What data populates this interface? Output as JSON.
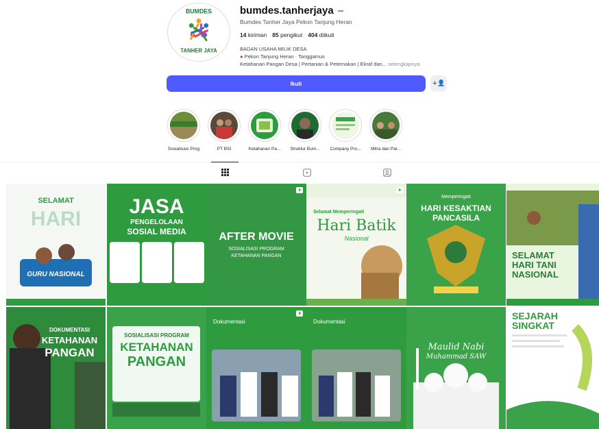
{
  "profile": {
    "username": "bumdes.tanherjaya",
    "fullname": "Bumdes Tanher Jaya Pekon Tanjung Heran",
    "stats": [
      {
        "count": "14",
        "label": "kiriman"
      },
      {
        "count": "85",
        "label": "pengikut"
      },
      {
        "count": "404",
        "label": "diikuti"
      }
    ],
    "bio_line1": "BADAN USAHA MILIK DESA",
    "bio_line2": "Pekon Tanjung Heran · Tanggamus",
    "bio_line3": "Ketahanan Pangan Desa | Pertanian & Peternakan | Ekraf dan...",
    "bio_more": "selengkapnya",
    "logo_top": "BUMDES",
    "logo_bottom": "TANHER JAYA"
  },
  "actions": {
    "follow_label": "Ikuti",
    "adduser_icon": "add-user-icon"
  },
  "highlights": [
    {
      "label": "Sosialisasi Prog"
    },
    {
      "label": "PT BSI"
    },
    {
      "label": "Ketahanan Pa..."
    },
    {
      "label": "Struktur Bum..."
    },
    {
      "label": "Company Pro..."
    },
    {
      "label": "Mitra dan Par..."
    }
  ],
  "tabs": [
    {
      "icon": "grid-icon",
      "active": true
    },
    {
      "icon": "reels-icon",
      "active": false
    },
    {
      "icon": "tagged-icon",
      "active": false
    }
  ],
  "posts": [
    {
      "line1": "SELAMAT",
      "line2": "HARI",
      "line3": "GURU NASIONAL"
    },
    {
      "line1": "JASA",
      "line2": "PENGELOLAAN",
      "line3": "SOSIAL MEDIA"
    },
    {
      "line1": "AFTER MOVIE",
      "line2": "SOSIALISASI PROGRAM",
      "line3": "KETAHANAN PANGAN"
    },
    {
      "line1": "Selamat Memperingati",
      "line2": "Hari Batik",
      "line3": "Nasional"
    },
    {
      "line1": "Memperingati",
      "line2": "HARI KESAKTIAN",
      "line3": "PANCASILA"
    },
    {
      "line1": "SELAMAT",
      "line2": "HARI TANI",
      "line3": "NASIONAL"
    },
    {
      "line1": "DOKUMENTASI",
      "line2": "KETAHANAN",
      "line3": "PANGAN"
    },
    {
      "line1": "SOSIALISASI PROGRAM",
      "line2": "KETAHANAN",
      "line3": "PANGAN"
    },
    {
      "line1": "Dokumentasi",
      "line2": "",
      "line3": ""
    },
    {
      "line1": "Dokumentasi",
      "line2": "",
      "line3": ""
    },
    {
      "line1": "Maulid Nabi",
      "line2": "Muhammad SAW",
      "line3": ""
    },
    {
      "line1": "SEJARAH",
      "line2": "SINGKAT",
      "line3": ""
    }
  ],
  "colors": {
    "follow_blue": "#4f5bff",
    "brand_green": "#2e9b3f",
    "light_green": "#7fd36b"
  }
}
